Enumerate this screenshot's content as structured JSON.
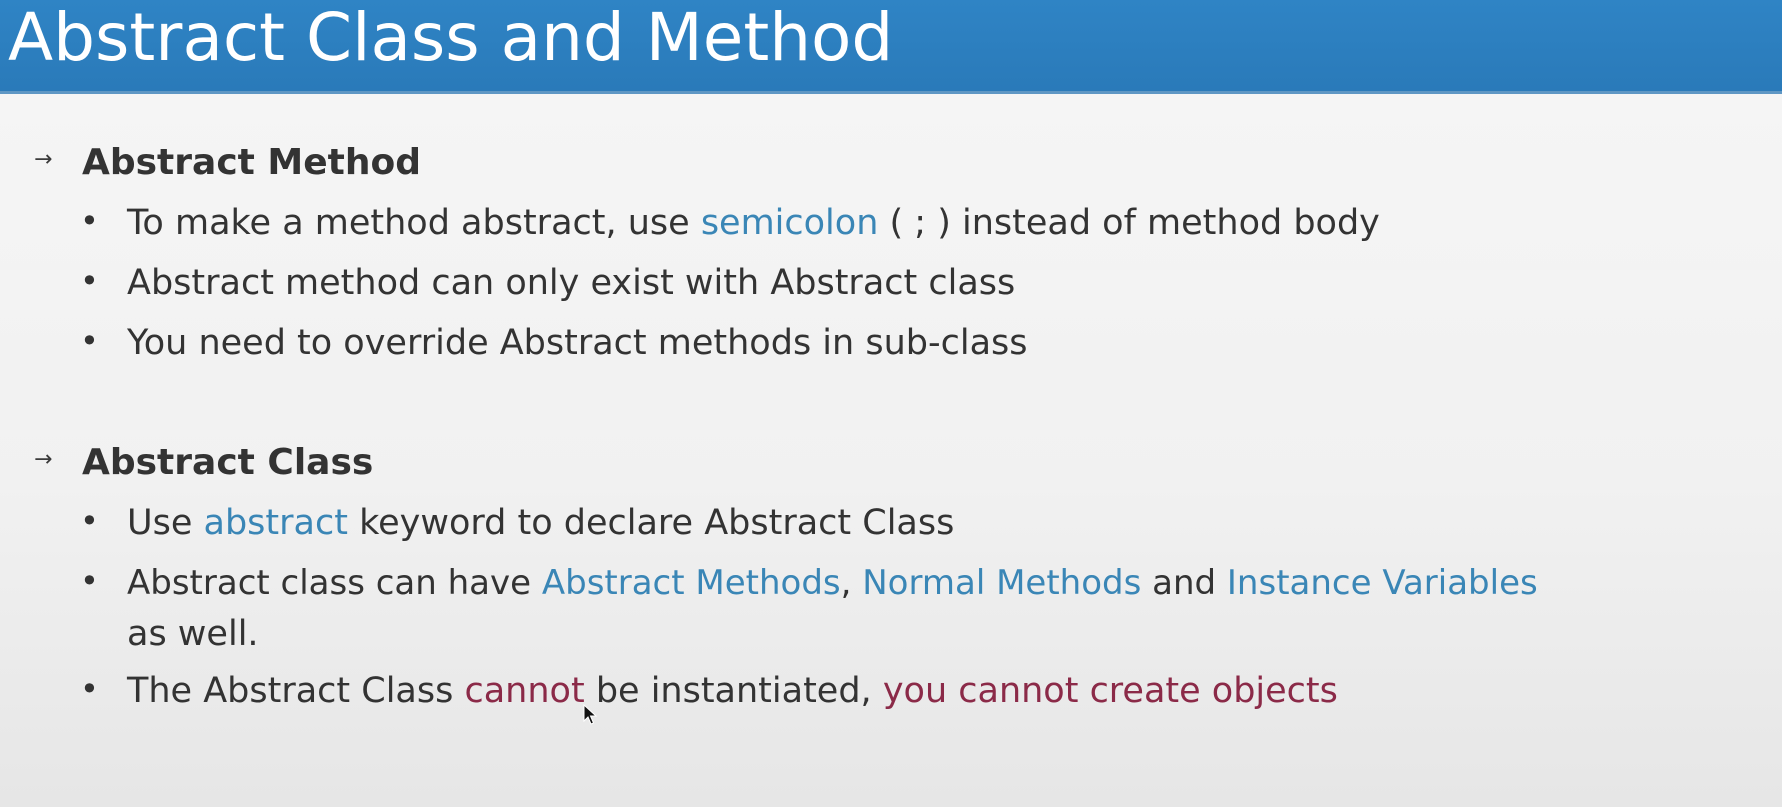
{
  "slide": {
    "title": "Abstract Class and Method"
  },
  "sections": [
    {
      "arrow": "→",
      "title": "Abstract Method",
      "bullets": [
        {
          "segments": [
            {
              "text": "To make a method abstract, use ",
              "style": "normal"
            },
            {
              "text": "semicolon",
              "style": "blue"
            },
            {
              "text": " ( ; ) instead of method body",
              "style": "normal"
            }
          ]
        },
        {
          "segments": [
            {
              "text": "Abstract method can only exist with Abstract class",
              "style": "normal"
            }
          ]
        },
        {
          "segments": [
            {
              "text": "You need to override Abstract methods in sub-class",
              "style": "normal"
            }
          ]
        }
      ]
    },
    {
      "arrow": "→",
      "title": "Abstract Class",
      "bullets": [
        {
          "segments": [
            {
              "text": "Use ",
              "style": "normal"
            },
            {
              "text": "abstract",
              "style": "blue"
            },
            {
              "text": " keyword to declare Abstract Class",
              "style": "normal"
            }
          ]
        },
        {
          "segments": [
            {
              "text": "Abstract class can have ",
              "style": "normal"
            },
            {
              "text": "Abstract Methods",
              "style": "blue"
            },
            {
              "text": ", ",
              "style": "normal"
            },
            {
              "text": "Normal Methods",
              "style": "blue"
            },
            {
              "text": " and ",
              "style": "normal"
            },
            {
              "text": "Instance Variables",
              "style": "blue"
            }
          ],
          "continuation": "as well."
        },
        {
          "segments": [
            {
              "text": "The Abstract Class ",
              "style": "normal"
            },
            {
              "text": "cannot",
              "style": "red"
            },
            {
              "text": " be instantiated, ",
              "style": "normal"
            },
            {
              "text": "you cannot create objects",
              "style": "red"
            }
          ]
        }
      ]
    }
  ],
  "colors": {
    "title_bar": "#2f84c5",
    "highlight_blue": "#3a86b6",
    "highlight_red": "#8b2a48",
    "text": "#333333"
  },
  "icons": {
    "section_marker": "arrow-right-icon",
    "bullet": "bullet-dot-icon",
    "pointer": "mouse-cursor-icon"
  }
}
